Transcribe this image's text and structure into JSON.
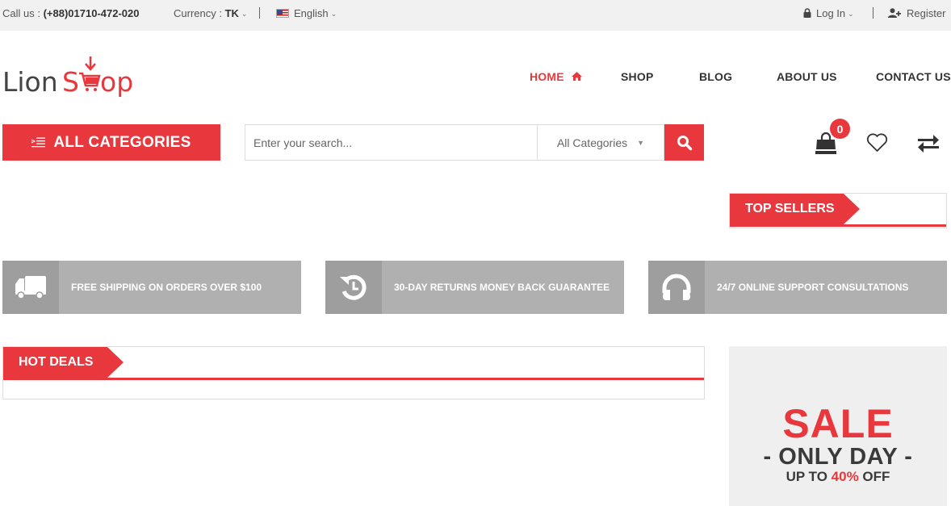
{
  "topbar": {
    "call_label": "Call us : ",
    "phone": "(+88)01710-472-020",
    "currency_label": "Currency : ",
    "currency_value": "TK",
    "language": "English",
    "login": "Log In",
    "register": "Register"
  },
  "brand": {
    "part1": "Lion",
    "part2": "S",
    "part3": "op",
    "accent_color": "#e8383d"
  },
  "nav": {
    "items": [
      {
        "label": "HOME",
        "active": true
      },
      {
        "label": "SHOP",
        "active": false
      },
      {
        "label": "BLOG",
        "active": false
      },
      {
        "label": "ABOUT US",
        "active": false
      },
      {
        "label": "CONTACT US",
        "active": false
      }
    ]
  },
  "search": {
    "all_categories_button": "ALL CATEGORIES",
    "placeholder": "Enter your search...",
    "category_select": "All Categories"
  },
  "header_icons": {
    "cart_count": "0"
  },
  "sections": {
    "top_sellers": "TOP SELLERS",
    "hot_deals": "HOT DEALS"
  },
  "services": [
    {
      "icon": "truck-icon",
      "text": "FREE SHIPPING ON ORDERS OVER $100"
    },
    {
      "icon": "history-icon",
      "text": "30-DAY RETURNS MONEY BACK GUARANTEE"
    },
    {
      "icon": "headphones-icon",
      "text": "24/7 ONLINE SUPPORT CONSULTATIONS"
    }
  ],
  "sale_banner": {
    "headline": "SALE",
    "subline": "- ONLY DAY -",
    "offer_prefix": "UP TO ",
    "offer_percent": "40%",
    "offer_suffix": " OFF"
  }
}
